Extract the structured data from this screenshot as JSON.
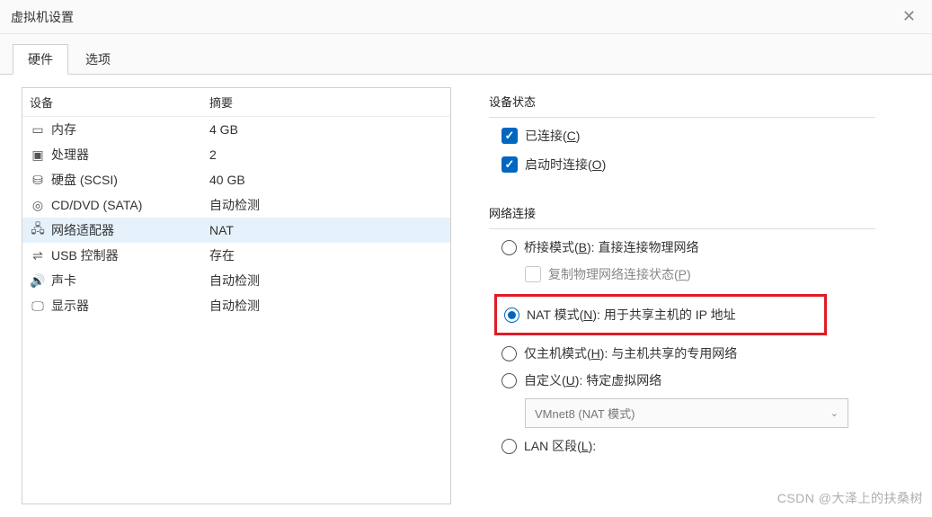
{
  "window": {
    "title": "虚拟机设置"
  },
  "tabs": {
    "hardware": "硬件",
    "options": "选项"
  },
  "hw_header": {
    "device": "设备",
    "summary": "摘要"
  },
  "hw": [
    {
      "icon": "memory",
      "name": "内存",
      "summary": "4 GB"
    },
    {
      "icon": "cpu",
      "name": "处理器",
      "summary": "2"
    },
    {
      "icon": "disk",
      "name": "硬盘 (SCSI)",
      "summary": "40 GB"
    },
    {
      "icon": "cd",
      "name": "CD/DVD (SATA)",
      "summary": "自动检测"
    },
    {
      "icon": "net",
      "name": "网络适配器",
      "summary": "NAT"
    },
    {
      "icon": "usb",
      "name": "USB 控制器",
      "summary": "存在"
    },
    {
      "icon": "sound",
      "name": "声卡",
      "summary": "自动检测"
    },
    {
      "icon": "display",
      "name": "显示器",
      "summary": "自动检测"
    }
  ],
  "device_state": {
    "title": "设备状态",
    "connected": "已连接(",
    "connected_u": "C",
    "connected_end": ")",
    "connect_on": "启动时连接(",
    "connect_on_u": "O",
    "connect_on_end": ")"
  },
  "net": {
    "title": "网络连接",
    "bridged_pre": "桥接模式(",
    "bridged_u": "B",
    "bridged_post": "): 直接连接物理网络",
    "replicate_pre": "复制物理网络连接状态(",
    "replicate_u": "P",
    "replicate_end": ")",
    "nat_pre": "NAT 模式(",
    "nat_u": "N",
    "nat_post": "): 用于共享主机的 IP 地址",
    "host_pre": "仅主机模式(",
    "host_u": "H",
    "host_post": "): 与主机共享的专用网络",
    "custom_pre": "自定义(",
    "custom_u": "U",
    "custom_post": "): 特定虚拟网络",
    "custom_value": "VMnet8 (NAT 模式)",
    "lan_pre": "LAN 区段(",
    "lan_u": "L",
    "lan_post": "):"
  },
  "watermark": "CSDN @大泽上的扶桑树"
}
